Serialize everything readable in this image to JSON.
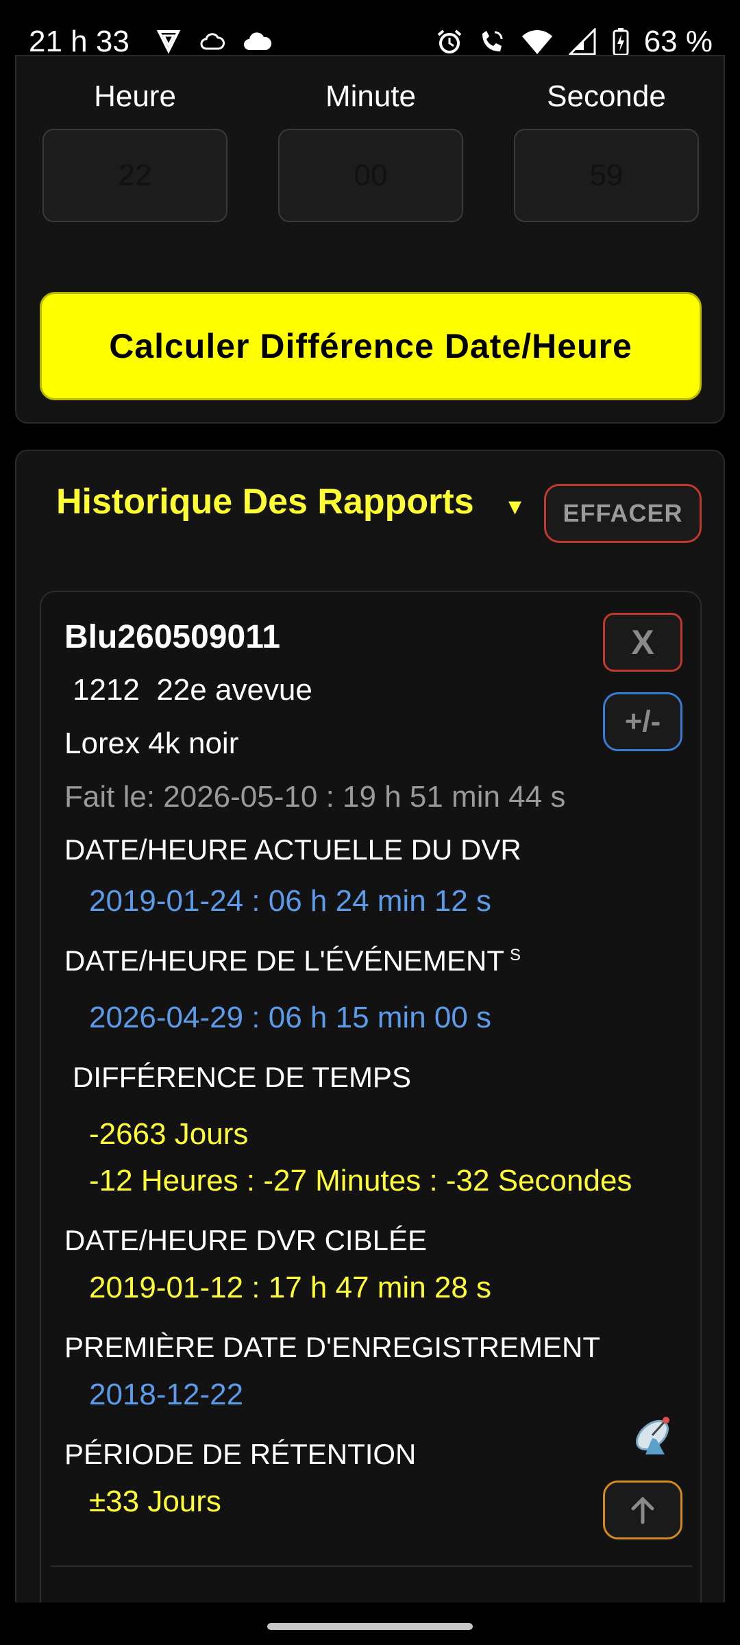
{
  "status_bar": {
    "time": "21 h 33",
    "battery_text": "63 %",
    "icons_left": [
      "vpn-shield-icon",
      "cloud-outline-icon",
      "cloud-icon"
    ],
    "icons_right": [
      "alarm-icon",
      "wifi-calling-icon",
      "wifi-icon",
      "signal-icon",
      "battery-charging-icon"
    ]
  },
  "time_inputs": {
    "hour": {
      "label": "Heure",
      "value": "22"
    },
    "minute": {
      "label": "Minute",
      "value": "00"
    },
    "second": {
      "label": "Seconde",
      "value": "59"
    }
  },
  "calc_button": "Calculer Différence Date/Heure",
  "history": {
    "title": "Historique Des Rapports",
    "caret": "▾",
    "clear_button": "EFFACER",
    "report": {
      "id": "Blu260509011",
      "address": "1212  22e avevue",
      "device": "Lorex 4k noir",
      "done_on": "Fait le: 2026-05-10 : 19 h 51 min 44 s",
      "dvr_current_label": "DATE/HEURE ACTUELLE DU DVR",
      "dvr_current_value": "2019-01-24 : 06 h 24 min 12 s",
      "event_label": "DATE/HEURE DE L'ÉVÉNEMENT",
      "event_sup": "S",
      "event_value": "2026-04-29 : 06 h 15 min 00 s",
      "diff_label": "DIFFÉRENCE DE TEMPS",
      "diff_days": "-2663 Jours",
      "diff_hms": "-12 Heures : -27 Minutes : -32 Secondes",
      "target_label": "DATE/HEURE DVR CIBLÉE",
      "target_value": "2019-01-12 : 17 h 47 min 28 s",
      "first_rec_label": "PREMIÈRE DATE D'ENREGISTREMENT",
      "first_rec_value": "2018-12-22",
      "retention_label": "PÉRIODE DE RÉTENTION",
      "retention_value": "±33 Jours",
      "delete_button": "X",
      "adjust_button": "+/-"
    }
  },
  "colors": {
    "accent_yellow": "#ffff00",
    "value_blue": "#5b9bea",
    "danger_red": "#c0392b",
    "info_blue": "#3a7bd5",
    "orange": "#d4881f"
  }
}
